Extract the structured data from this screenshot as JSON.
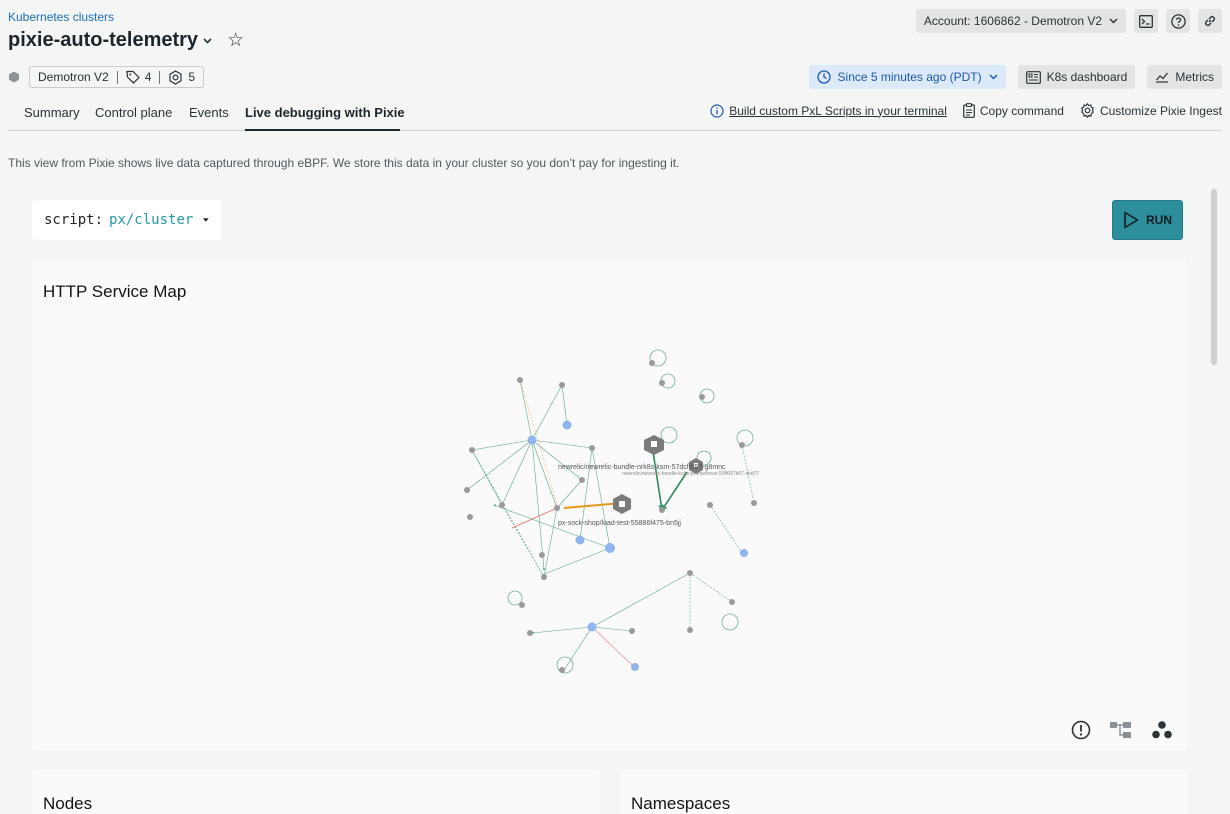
{
  "breadcrumb": "Kubernetes clusters",
  "title": "pixie-auto-telemetry",
  "account": "Account: 1606862 - Demotron V2",
  "meta": {
    "entity": "Demotron V2",
    "tags": "4",
    "related": "5"
  },
  "time_picker": "Since 5 minutes ago (PDT)",
  "actions": {
    "k8s": "K8s dashboard",
    "metrics": "Metrics"
  },
  "tabs": [
    {
      "label": "Summary"
    },
    {
      "label": "Control plane"
    },
    {
      "label": "Events"
    },
    {
      "label": "Live debugging with Pixie",
      "active": true
    }
  ],
  "tab_actions": {
    "build": "Build custom PxL Scripts in your terminal",
    "copy": "Copy command",
    "customize": "Customize Pixie Ingest"
  },
  "description": "This view from Pixie shows live data captured through eBPF. We store this data in your cluster so you don’t pay for ingesting it.",
  "script": {
    "key": "script:",
    "value": "px/cluster"
  },
  "run_label": "RUN",
  "cards": {
    "service_map": "HTTP Service Map",
    "nodes": "Nodes",
    "namespaces": "Namespaces"
  },
  "graph_labels": {
    "a": "newrelic/newrelic-bundle-nrk8s-ksm-57dcff657-g8mnc",
    "b": "newrelic/newrelic-bundle-kube-prometheus-55ff657b67-xhd77",
    "c": "px-sock-shop/load-test-55886f475-bn5jj"
  },
  "colors": {
    "accent": "#2e8f9c",
    "link": "#1d6fb8",
    "time_bg": "#dbe9f8"
  }
}
